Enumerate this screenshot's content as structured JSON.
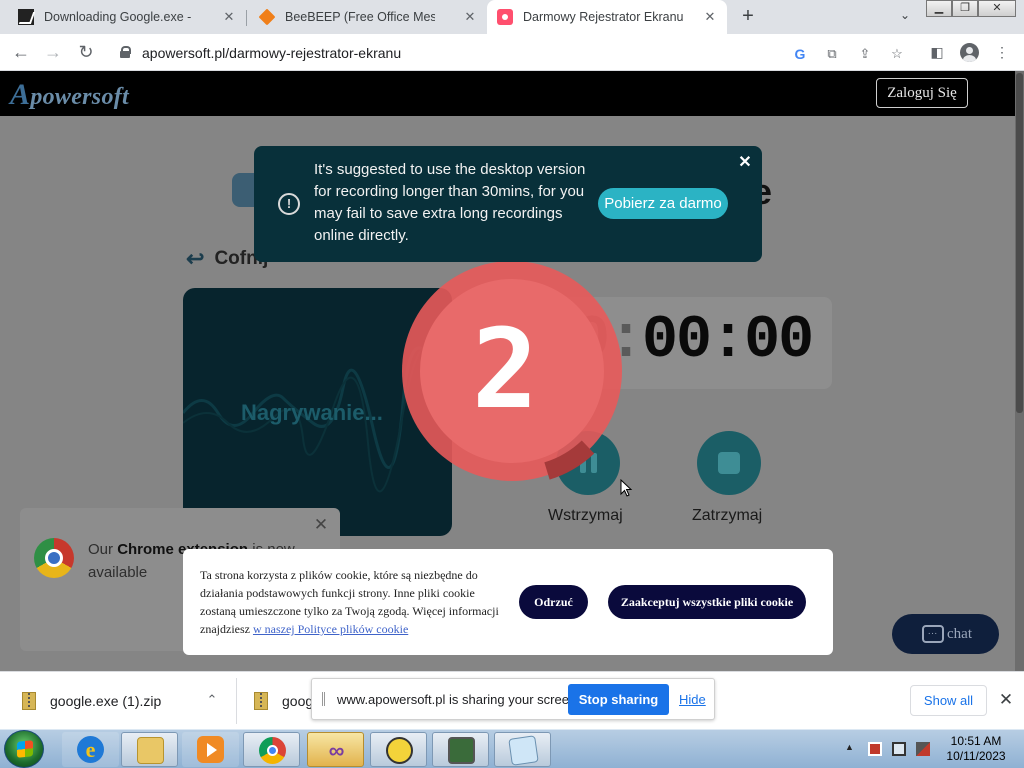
{
  "browser": {
    "tabs": [
      {
        "title": "Downloading Google.exe - Game",
        "icon": "download-page-favicon"
      },
      {
        "title": "BeeBEEP (Free Office Messenger)",
        "icon": "beebeep-favicon"
      },
      {
        "title": "Darmowy Rejestrator Ekranu",
        "icon": "apowersoft-recorder-favicon",
        "active": true
      }
    ],
    "url": "apowersoft.pl/darmowy-rejestrator-ekranu"
  },
  "site": {
    "logo_first": "A",
    "logo_rest": "powersoft",
    "login_label": "Zaloguj Się",
    "title_tail": "e",
    "back_label": "Cofnij"
  },
  "suggestion": {
    "icon": "!",
    "text": "It's suggested to use the desktop version for recording longer than 30mins, for you may fail to save extra long recordings online directly.",
    "download_label": "Pobierz za darmo",
    "close_label": "✕"
  },
  "recorder": {
    "status_label": "Nagrywanie...",
    "timer_hours": "00",
    "timer_minutes": "00",
    "timer_seconds": "00",
    "timer_sep": ":",
    "countdown": "2",
    "pause_label": "Wstrzymaj",
    "stop_label": "Zatrzymaj"
  },
  "extension_popup": {
    "prefix": "Our ",
    "bold": "Chrome extension",
    "suffix": " is now available",
    "close_label": "✕"
  },
  "cookie_banner": {
    "text": "Ta strona korzysta z plików cookie, które są niezbędne do działania podstawowych funkcji strony. Inne pliki cookie zostaną umieszczone tylko za Twoją zgodą. Więcej informacji znajdziesz ",
    "link_text": "w naszej Polityce plików cookie",
    "reject_label": "Odrzuć",
    "accept_label": "Zaakceptuj wszystkie pliki cookie"
  },
  "chat": {
    "label": "chat",
    "dots": "..."
  },
  "downloads": {
    "items": [
      {
        "name": "google.exe (1).zip"
      },
      {
        "name": "goog"
      }
    ],
    "share_text": "www.apowersoft.pl is sharing your screen.",
    "stop_sharing_label": "Stop sharing",
    "hide_label": "Hide",
    "show_all_label": "Show all"
  },
  "taskbar": {
    "time": "10:51 AM",
    "date": "10/11/2023",
    "tray_toggle": "▲"
  }
}
